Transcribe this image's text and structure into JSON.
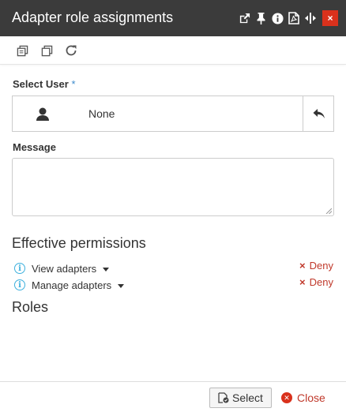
{
  "window": {
    "title": "Adapter role assignments",
    "icons": [
      "external-link-icon",
      "pin-icon",
      "info-icon",
      "pdf-icon",
      "resize-icon"
    ],
    "close_label": "×",
    "accent": "#d9311c"
  },
  "toolbar": {
    "icons": [
      "copy-icon",
      "paste-icon",
      "refresh-icon"
    ]
  },
  "form": {
    "select_user_label": "Select User",
    "required_mark": "*",
    "user_value": "None",
    "message_label": "Message",
    "message_value": ""
  },
  "permissions": {
    "heading": "Effective permissions",
    "items": [
      {
        "label": "View adapters",
        "status": "Deny"
      },
      {
        "label": "Manage adapters",
        "status": "Deny"
      }
    ]
  },
  "roles": {
    "heading": "Roles"
  },
  "footer": {
    "select_label": "Select",
    "close_label": "Close"
  }
}
